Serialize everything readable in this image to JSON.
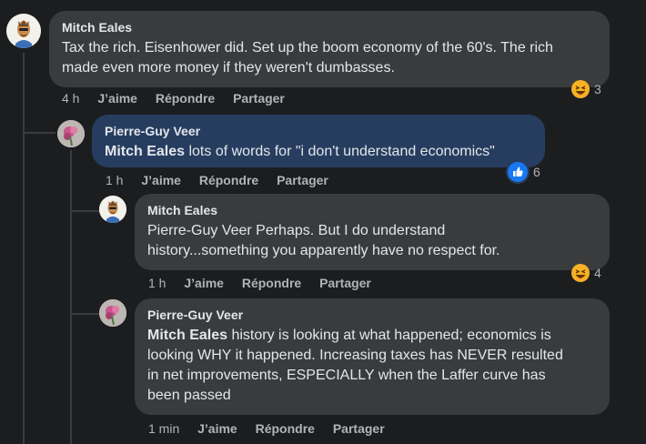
{
  "comments": [
    {
      "author": "Mitch Eales",
      "mention": "",
      "text_line1": "Tax the rich. Eisenhower did. Set up the boom economy of the 60's. The rich",
      "text_line2": "made even more money if they weren't dumbasses.",
      "text_line3": "",
      "text_line4": "",
      "time": "4 h",
      "reaction_count": "3",
      "reaction_icon": "haha-icon"
    },
    {
      "author": "Pierre-Guy Veer",
      "mention": "Mitch Eales",
      "text_line1": " lots of words for \"i don't understand economics\"",
      "time": "1 h",
      "reaction_count": "6",
      "reaction_icon": "like-icon"
    },
    {
      "author": "Mitch Eales",
      "mention": "",
      "text_line1": "Pierre-Guy Veer Perhaps. But I do understand",
      "text_line2": "history...something you apparently have no respect for.",
      "time": "1 h",
      "reaction_count": "4",
      "reaction_icon": "haha-icon"
    },
    {
      "author": "Pierre-Guy Veer",
      "mention": "Mitch Eales",
      "text_line1": " history is looking at what happened; economics is",
      "text_line2": "looking WHY it happened. Increasing taxes has NEVER resulted",
      "text_line3": "in net improvements, ESPECIALLY when the Laffer curve has",
      "text_line4": "been passed",
      "time": "1 min"
    }
  ],
  "actions": {
    "like": "J’aime",
    "reply": "Répondre",
    "share": "Partager"
  },
  "colors": {
    "background": "#1c1d1f",
    "bubble": "#3a3b3c",
    "bubble_highlight": "#263d5f",
    "meta_text": "#b0b3b8",
    "like_blue": "#1877f2"
  }
}
